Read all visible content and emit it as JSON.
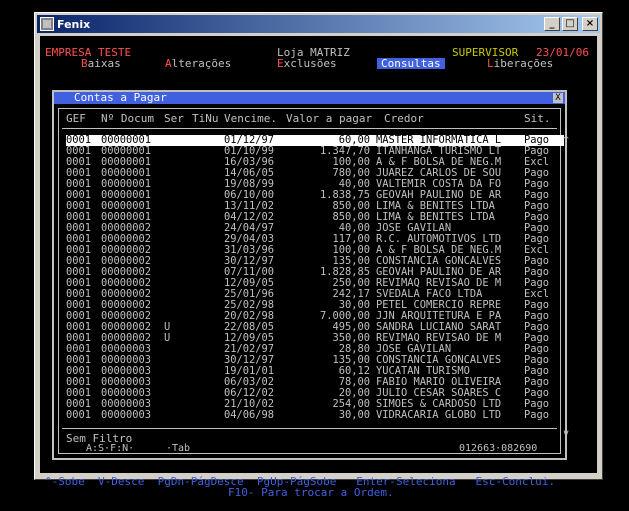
{
  "window": {
    "title": "Fenix"
  },
  "header": {
    "company": "EMPRESA TESTE",
    "store": "Loja MATRIZ",
    "user": "SUPERVISOR",
    "date": "23/01/06"
  },
  "menu": [
    {
      "hotkey": "B",
      "rest": "aixas"
    },
    {
      "hotkey": "A",
      "rest": "lterações"
    },
    {
      "hotkey": "E",
      "rest": "xclusões"
    },
    {
      "hotkey": "",
      "rest": "Consultas"
    },
    {
      "hotkey": "L",
      "rest": "iberações"
    }
  ],
  "dialog": {
    "title": "Contas a Pagar",
    "close": "X",
    "columns": [
      "GEF",
      "Nº Docum",
      "Ser",
      "TiNu",
      "Vencime.",
      "Valor a pagar",
      "Credor",
      "Sit."
    ],
    "rows": [
      [
        "0001",
        "00000001",
        "",
        "",
        "01/12/97",
        "60,00",
        "MASTER INFORMATICA L",
        "Pago"
      ],
      [
        "0001",
        "00000001",
        "",
        "",
        "01/10/99",
        "1.347,70",
        "ITANHANGA TURISMO LT",
        "Pago"
      ],
      [
        "0001",
        "00000001",
        "",
        "",
        "16/03/96",
        "100,00",
        "A & F BOLSA DE NEG.M",
        "Excl"
      ],
      [
        "0001",
        "00000001",
        "",
        "",
        "14/06/05",
        "780,00",
        "JUAREZ CARLOS DE SOU",
        "Pago"
      ],
      [
        "0001",
        "00000001",
        "",
        "",
        "19/08/99",
        "40,00",
        "VALTEMIR COSTA DA FO",
        "Pago"
      ],
      [
        "0001",
        "00000001",
        "",
        "",
        "06/10/00",
        "1.838,75",
        "GEOVAH PAULINO DE AR",
        "Pago"
      ],
      [
        "0001",
        "00000001",
        "",
        "",
        "13/11/02",
        "850,00",
        "LIMA & BENITES LTDA",
        "Pago"
      ],
      [
        "0001",
        "00000001",
        "",
        "",
        "04/12/02",
        "850,00",
        "LIMA & BENITES LTDA",
        "Pago"
      ],
      [
        "0001",
        "00000002",
        "",
        "",
        "24/04/97",
        "40,00",
        "JOSE GAVILAN",
        "Pago"
      ],
      [
        "0001",
        "00000002",
        "",
        "",
        "29/04/03",
        "117,00",
        "R.C. AUTOMOTIVOS LTD",
        "Pago"
      ],
      [
        "0001",
        "00000002",
        "",
        "",
        "31/03/96",
        "100,00",
        "A & F BOLSA DE NEG.M",
        "Excl"
      ],
      [
        "0001",
        "00000002",
        "",
        "",
        "30/12/97",
        "135,00",
        "CONSTANCIA GONCALVES",
        "Pago"
      ],
      [
        "0001",
        "00000002",
        "",
        "",
        "07/11/00",
        "1.828,85",
        "GEOVAH PAULINO DE AR",
        "Pago"
      ],
      [
        "0001",
        "00000002",
        "",
        "",
        "12/09/05",
        "250,00",
        "REVIMAQ REVISAO DE M",
        "Pago"
      ],
      [
        "0001",
        "00000002",
        "",
        "",
        "25/01/96",
        "242,17",
        "SVEDALA FACO LTDA",
        "Excl"
      ],
      [
        "0001",
        "00000002",
        "",
        "",
        "25/02/98",
        "30,00",
        "PETEL COMERCIO REPRE",
        "Pago"
      ],
      [
        "0001",
        "00000002",
        "",
        "",
        "20/02/98",
        "7.000,00",
        "JJN ARQUITETURA E PA",
        "Pago"
      ],
      [
        "0001",
        "00000002",
        "U",
        "",
        "22/08/05",
        "495,00",
        "SANDRA LUCIANO SARAT",
        "Pago"
      ],
      [
        "0001",
        "00000002",
        "U",
        "",
        "12/09/05",
        "350,00",
        "REVIMAQ REVISAO DE M",
        "Pago"
      ],
      [
        "0001",
        "00000003",
        "",
        "",
        "21/02/97",
        "28,80",
        "JOSE GAVILAN",
        "Pago"
      ],
      [
        "0001",
        "00000003",
        "",
        "",
        "30/12/97",
        "135,00",
        "CONSTANCIA GONCALVES",
        "Pago"
      ],
      [
        "0001",
        "00000003",
        "",
        "",
        "19/01/01",
        "60,12",
        "YUCATAN TURISMO",
        "Pago"
      ],
      [
        "0001",
        "00000003",
        "",
        "",
        "06/03/02",
        "78,00",
        "FABIO MARIO OLIVEIRA",
        "Pago"
      ],
      [
        "0001",
        "00000003",
        "",
        "",
        "06/12/02",
        "20,00",
        "JULIO CESAR SOARES C",
        "Pago"
      ],
      [
        "0001",
        "00000003",
        "",
        "",
        "21/10/02",
        "254,00",
        "SIMOES & CARDOSO LTD",
        "Pago"
      ],
      [
        "0001",
        "00000003",
        "",
        "",
        "04/06/98",
        "30,00",
        "VIDRACARIA GLOBO LTD",
        "Pago"
      ]
    ],
    "filter": "Sem Filtro",
    "footer_left": "A:S·F:N·",
    "footer_tab": "·Tab",
    "footer_range": "012663·082690",
    "scroll_up": "^",
    "scroll_down": "v"
  },
  "help": {
    "line1": "^-Sobe  V-Desce  PgDn-PágDesce  PgUp-PágSobe   Enter-Seleciona   Esc-Conclui.",
    "line2": "F10- Para trocar a Ordem."
  }
}
